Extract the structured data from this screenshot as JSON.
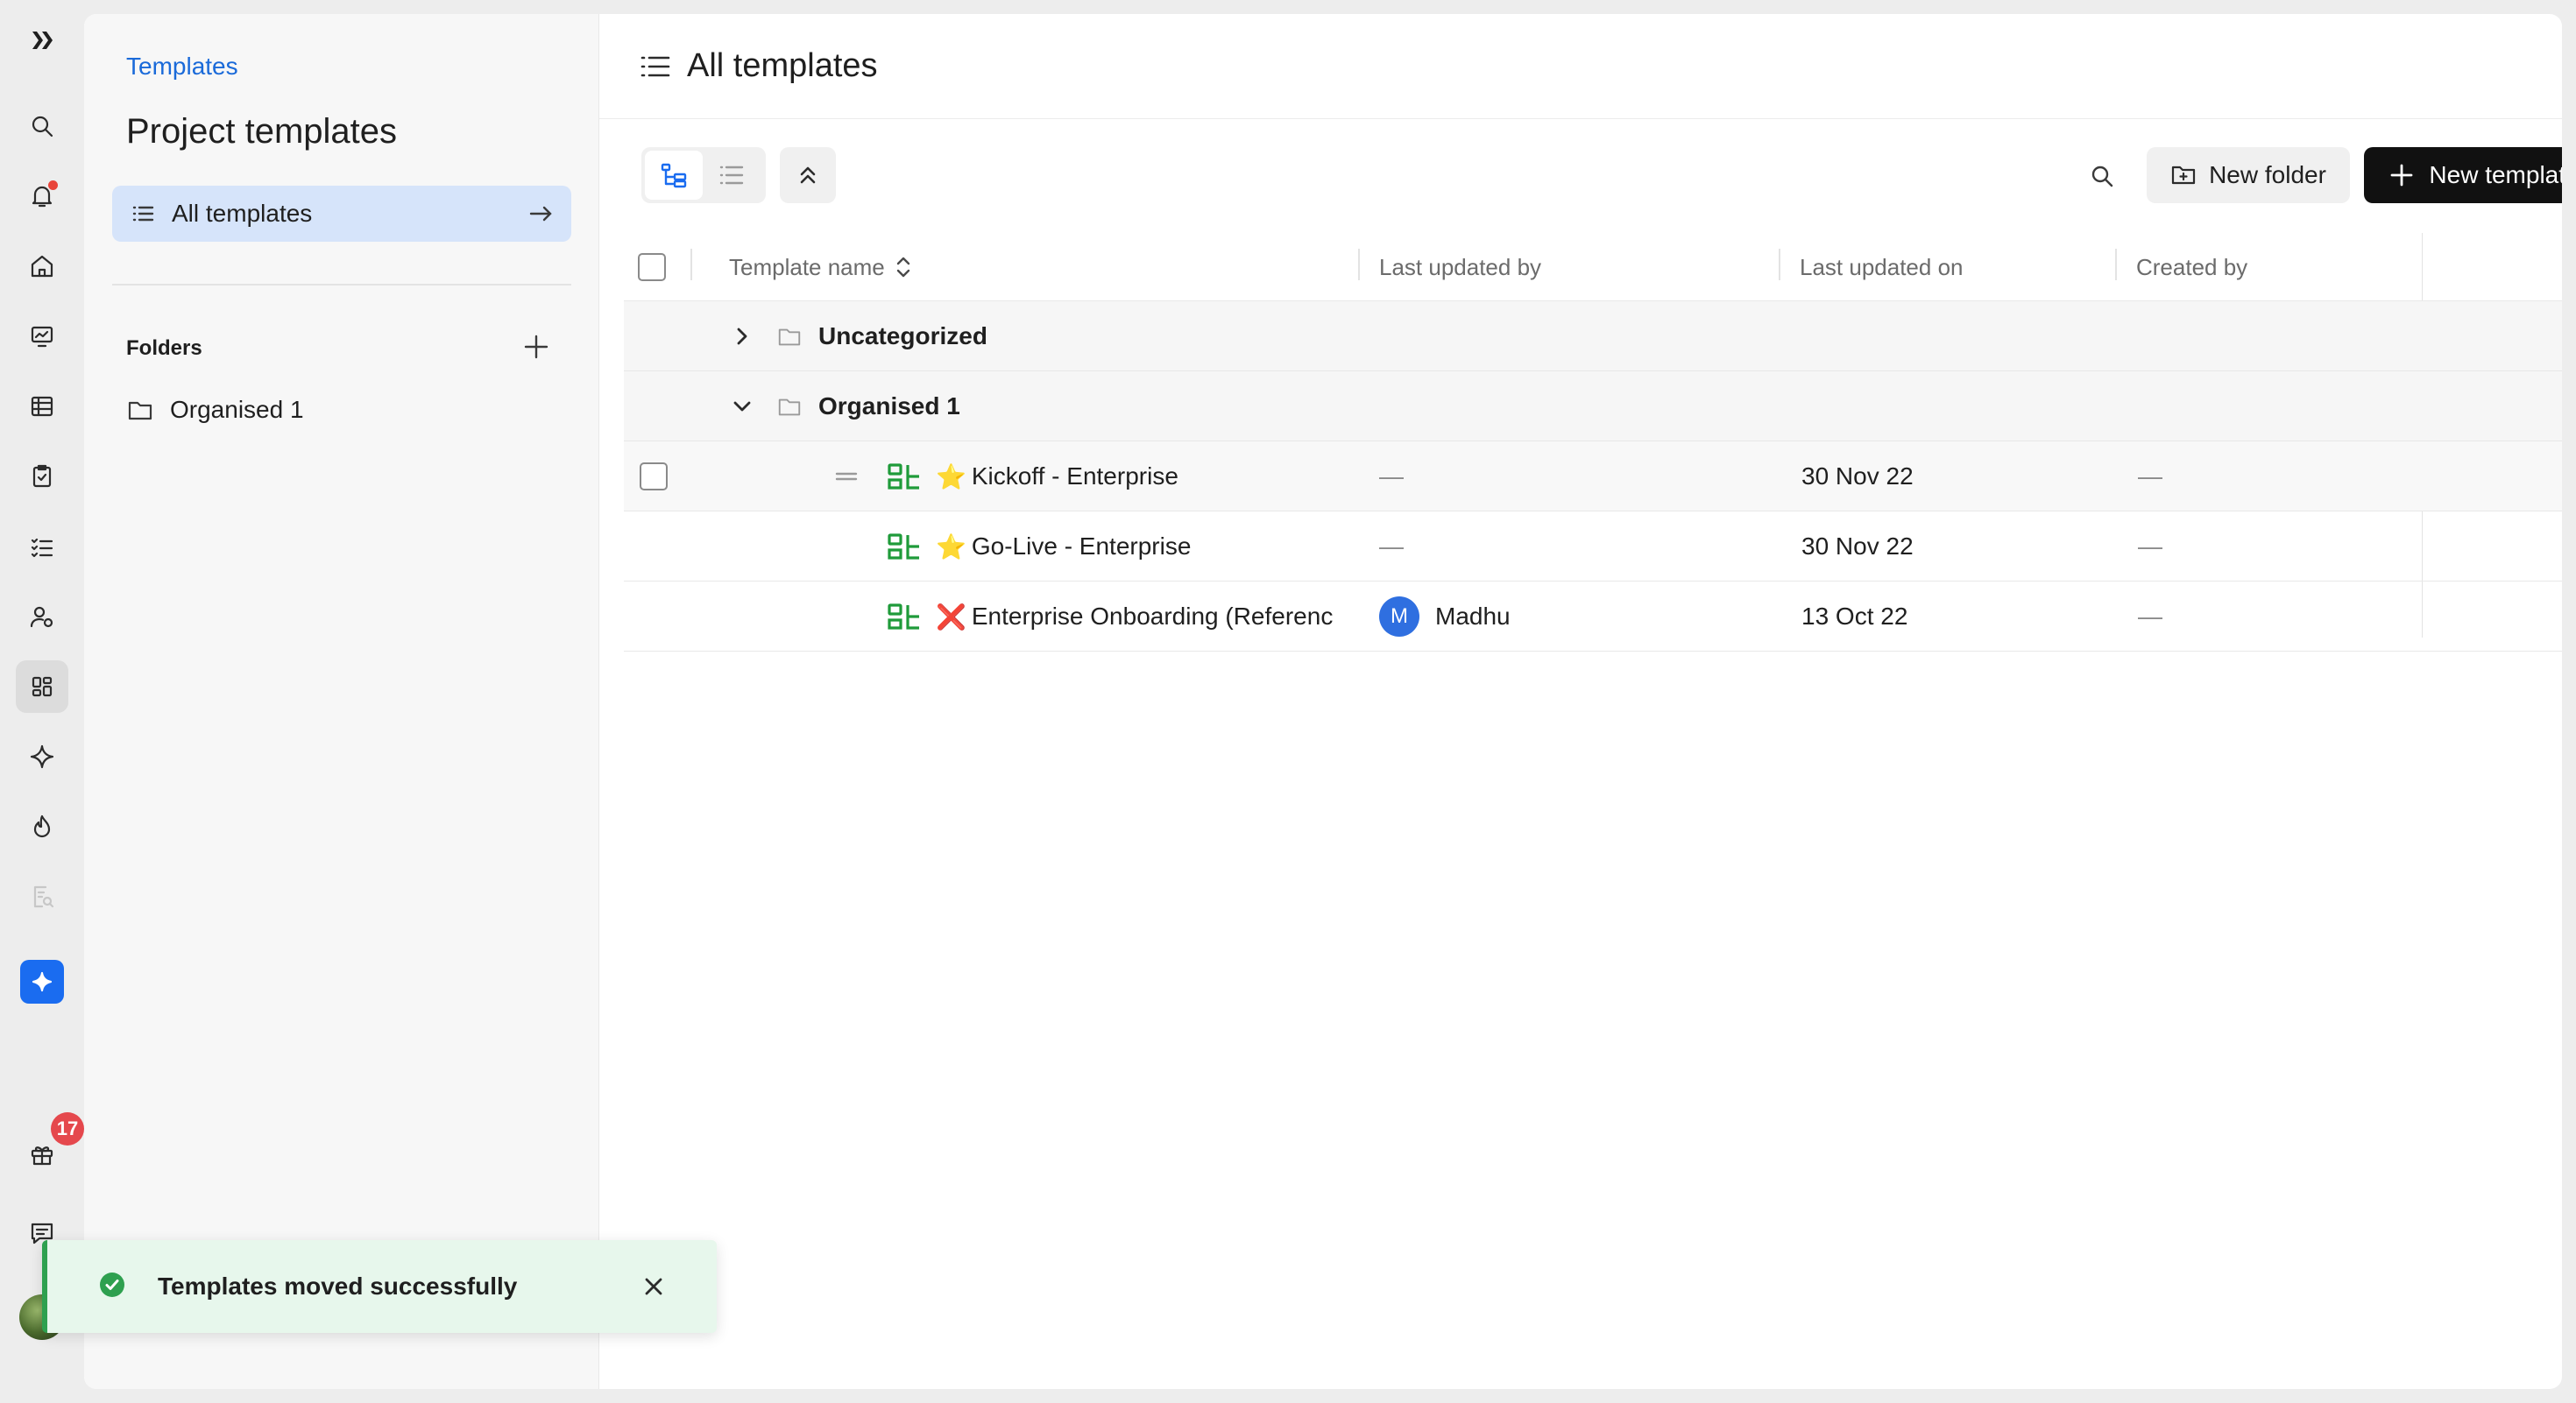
{
  "breadcrumb": "Templates",
  "panel": {
    "title": "Project templates",
    "all_templates_label": "All templates",
    "folders_heading": "Folders",
    "folders": [
      {
        "label": "Organised 1"
      }
    ]
  },
  "header": {
    "title": "All templates"
  },
  "toolbar": {
    "new_folder_label": "New folder",
    "new_template_label": "New template"
  },
  "table": {
    "columns": [
      "Template name",
      "Last updated by",
      "Last updated on",
      "Created by"
    ],
    "groups": [
      {
        "name": "Uncategorized",
        "expanded": false
      },
      {
        "name": "Organised 1",
        "expanded": true
      }
    ],
    "rows": [
      {
        "emoji": "⭐",
        "name": "Kickoff - Enterprise",
        "updated_by": "—",
        "updated_on": "30 Nov 22",
        "created_by": "—"
      },
      {
        "emoji": "⭐",
        "name": "Go-Live - Enterprise",
        "updated_by": "—",
        "updated_on": "30 Nov 22",
        "created_by": "—"
      },
      {
        "emoji": "❌",
        "name": "Enterprise Onboarding (Referenc",
        "updated_by_initial": "M",
        "updated_by": "Madhu",
        "updated_on": "13 Oct 22",
        "created_by": "—"
      }
    ]
  },
  "rail": {
    "gift_badge": "17"
  },
  "toast": {
    "message": "Templates moved successfully"
  },
  "colors": {
    "accent": "#1a6cf0",
    "success": "#2ea04f",
    "template_icon": "#1f9b3a",
    "selected_nav": "#d6e4fa"
  }
}
